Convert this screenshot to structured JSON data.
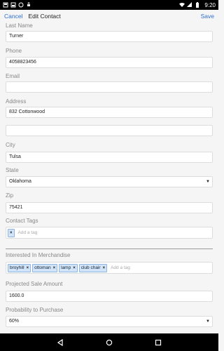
{
  "status_bar": {
    "time": "9:20",
    "left_icons": [
      "notification-icon",
      "notification-icon",
      "sync-icon",
      "android-icon"
    ]
  },
  "action_bar": {
    "cancel": "Cancel",
    "title": "Edit Contact",
    "save": "Save"
  },
  "form": {
    "last_name": {
      "label": "Last Name",
      "value": "Turner"
    },
    "phone": {
      "label": "Phone",
      "value": "4058823456"
    },
    "email": {
      "label": "Email",
      "value": ""
    },
    "address": {
      "label": "Address",
      "value": "832 Cottonwood",
      "value2": ""
    },
    "city": {
      "label": "City",
      "value": "Tulsa"
    },
    "state": {
      "label": "State",
      "value": "Oklahoma"
    },
    "zip": {
      "label": "Zip",
      "value": "75421"
    },
    "contact_tags": {
      "label": "Contact Tags",
      "tags": [],
      "placeholder": "Add a tag"
    },
    "merchandise": {
      "label": "Interested In Merchandise",
      "tags": [
        "broyhill",
        "ottoman",
        "lamp",
        "club chair"
      ],
      "placeholder": "Add a tag"
    },
    "projected_sale": {
      "label": "Projected Sale Amount",
      "value": "1600.0"
    },
    "probability": {
      "label": "Probability to Purchase",
      "value": "60%"
    }
  },
  "tag_remove_glyph": "×",
  "colors": {
    "accent": "#2f6fd0",
    "tag_bg": "#d2e4f8"
  }
}
